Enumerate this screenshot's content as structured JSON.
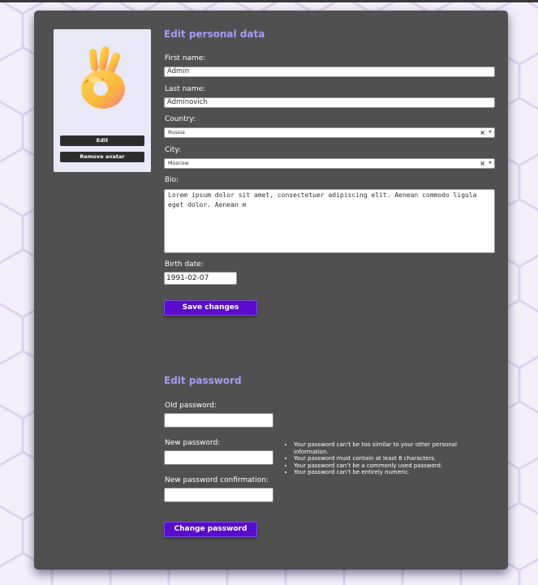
{
  "colors": {
    "accent": "#5a0ccc",
    "section_title": "#a59cf3",
    "card_bg": "#505050",
    "page_bg": "#f1edf8"
  },
  "avatar": {
    "icon": "ok-hand-emoji",
    "edit_label": "Edit",
    "remove_label": "Remove avatar"
  },
  "personal": {
    "title": "Edit personal data",
    "first_name": {
      "label": "First name:",
      "value": "Admin"
    },
    "last_name": {
      "label": "Last name:",
      "value": "Adminovich"
    },
    "country": {
      "label": "Country:",
      "value": "Russia",
      "clear": "×",
      "caret": "▼"
    },
    "city": {
      "label": "City:",
      "value": "Moscow",
      "clear": "×",
      "caret": "▼"
    },
    "bio": {
      "label": "Bio:",
      "value": "Lorem ipsum dolor sit amet, consectetuer adipiscing elit. Aenean commodo ligula eget dolor. Aenean m"
    },
    "birth_date": {
      "label": "Birth date:",
      "value": "1991-02-07"
    },
    "save_label": "Save changes"
  },
  "password": {
    "title": "Edit password",
    "old": {
      "label": "Old password:",
      "value": ""
    },
    "new": {
      "label": "New password:",
      "value": ""
    },
    "confirm": {
      "label": "New password confirmation:",
      "value": ""
    },
    "help": [
      "Your password can’t be too similar to your other personal information.",
      "Your password must contain at least 8 characters.",
      "Your password can’t be a commonly used password.",
      "Your password can’t be entirely numeric."
    ],
    "change_label": "Change password"
  }
}
